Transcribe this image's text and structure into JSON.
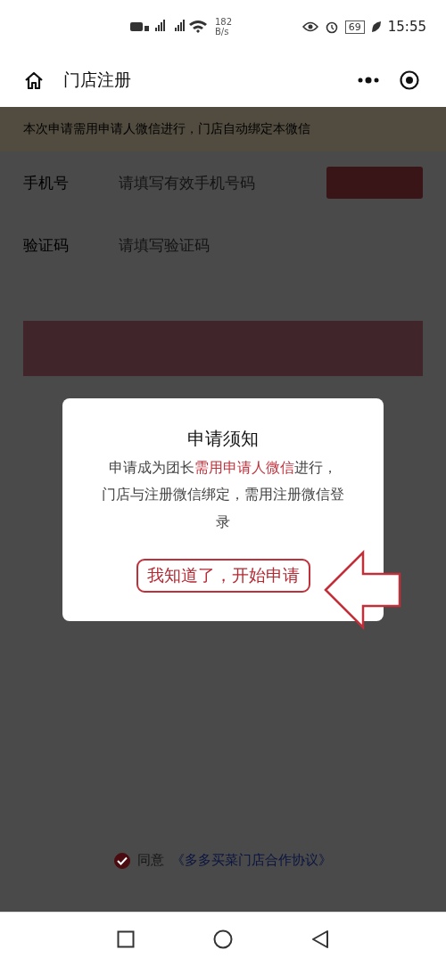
{
  "status_bar": {
    "speed": "182",
    "speed_unit": "B/s",
    "battery": "69",
    "time": "15:55"
  },
  "nav": {
    "title": "门店注册"
  },
  "notice": "本次申请需用申请人微信进行，门店自动绑定本微信",
  "fields": [
    {
      "label": "手机号",
      "placeholder": "请填写有效手机号码",
      "kind": "phone"
    },
    {
      "label": "验证码",
      "placeholder": "请填写验证码",
      "kind": "code"
    }
  ],
  "agreement": {
    "checked": true,
    "prefix": "同意",
    "link": "《多多买菜门店合作协议》"
  },
  "dialog": {
    "title": "申请须知",
    "body": [
      "申请成为团长**需用申请人微信**进行，",
      "门店与注册微信绑定，需用注册微信登录"
    ],
    "confirm": "我知道了，开始申请"
  }
}
